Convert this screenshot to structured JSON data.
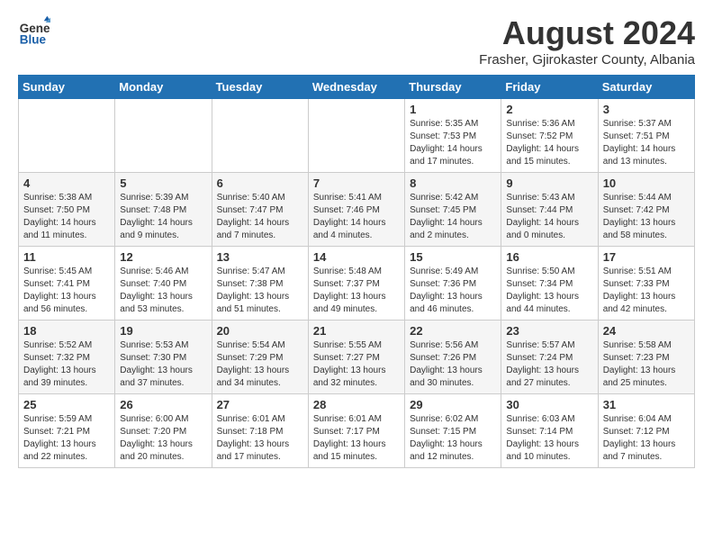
{
  "header": {
    "logo_general": "General",
    "logo_blue": "Blue",
    "main_title": "August 2024",
    "subtitle": "Frasher, Gjirokaster County, Albania"
  },
  "days_of_week": [
    "Sunday",
    "Monday",
    "Tuesday",
    "Wednesday",
    "Thursday",
    "Friday",
    "Saturday"
  ],
  "weeks": [
    {
      "days": [
        {
          "num": "",
          "info": ""
        },
        {
          "num": "",
          "info": ""
        },
        {
          "num": "",
          "info": ""
        },
        {
          "num": "",
          "info": ""
        },
        {
          "num": "1",
          "info": "Sunrise: 5:35 AM\nSunset: 7:53 PM\nDaylight: 14 hours\nand 17 minutes."
        },
        {
          "num": "2",
          "info": "Sunrise: 5:36 AM\nSunset: 7:52 PM\nDaylight: 14 hours\nand 15 minutes."
        },
        {
          "num": "3",
          "info": "Sunrise: 5:37 AM\nSunset: 7:51 PM\nDaylight: 14 hours\nand 13 minutes."
        }
      ]
    },
    {
      "days": [
        {
          "num": "4",
          "info": "Sunrise: 5:38 AM\nSunset: 7:50 PM\nDaylight: 14 hours\nand 11 minutes."
        },
        {
          "num": "5",
          "info": "Sunrise: 5:39 AM\nSunset: 7:48 PM\nDaylight: 14 hours\nand 9 minutes."
        },
        {
          "num": "6",
          "info": "Sunrise: 5:40 AM\nSunset: 7:47 PM\nDaylight: 14 hours\nand 7 minutes."
        },
        {
          "num": "7",
          "info": "Sunrise: 5:41 AM\nSunset: 7:46 PM\nDaylight: 14 hours\nand 4 minutes."
        },
        {
          "num": "8",
          "info": "Sunrise: 5:42 AM\nSunset: 7:45 PM\nDaylight: 14 hours\nand 2 minutes."
        },
        {
          "num": "9",
          "info": "Sunrise: 5:43 AM\nSunset: 7:44 PM\nDaylight: 14 hours\nand 0 minutes."
        },
        {
          "num": "10",
          "info": "Sunrise: 5:44 AM\nSunset: 7:42 PM\nDaylight: 13 hours\nand 58 minutes."
        }
      ]
    },
    {
      "days": [
        {
          "num": "11",
          "info": "Sunrise: 5:45 AM\nSunset: 7:41 PM\nDaylight: 13 hours\nand 56 minutes."
        },
        {
          "num": "12",
          "info": "Sunrise: 5:46 AM\nSunset: 7:40 PM\nDaylight: 13 hours\nand 53 minutes."
        },
        {
          "num": "13",
          "info": "Sunrise: 5:47 AM\nSunset: 7:38 PM\nDaylight: 13 hours\nand 51 minutes."
        },
        {
          "num": "14",
          "info": "Sunrise: 5:48 AM\nSunset: 7:37 PM\nDaylight: 13 hours\nand 49 minutes."
        },
        {
          "num": "15",
          "info": "Sunrise: 5:49 AM\nSunset: 7:36 PM\nDaylight: 13 hours\nand 46 minutes."
        },
        {
          "num": "16",
          "info": "Sunrise: 5:50 AM\nSunset: 7:34 PM\nDaylight: 13 hours\nand 44 minutes."
        },
        {
          "num": "17",
          "info": "Sunrise: 5:51 AM\nSunset: 7:33 PM\nDaylight: 13 hours\nand 42 minutes."
        }
      ]
    },
    {
      "days": [
        {
          "num": "18",
          "info": "Sunrise: 5:52 AM\nSunset: 7:32 PM\nDaylight: 13 hours\nand 39 minutes."
        },
        {
          "num": "19",
          "info": "Sunrise: 5:53 AM\nSunset: 7:30 PM\nDaylight: 13 hours\nand 37 minutes."
        },
        {
          "num": "20",
          "info": "Sunrise: 5:54 AM\nSunset: 7:29 PM\nDaylight: 13 hours\nand 34 minutes."
        },
        {
          "num": "21",
          "info": "Sunrise: 5:55 AM\nSunset: 7:27 PM\nDaylight: 13 hours\nand 32 minutes."
        },
        {
          "num": "22",
          "info": "Sunrise: 5:56 AM\nSunset: 7:26 PM\nDaylight: 13 hours\nand 30 minutes."
        },
        {
          "num": "23",
          "info": "Sunrise: 5:57 AM\nSunset: 7:24 PM\nDaylight: 13 hours\nand 27 minutes."
        },
        {
          "num": "24",
          "info": "Sunrise: 5:58 AM\nSunset: 7:23 PM\nDaylight: 13 hours\nand 25 minutes."
        }
      ]
    },
    {
      "days": [
        {
          "num": "25",
          "info": "Sunrise: 5:59 AM\nSunset: 7:21 PM\nDaylight: 13 hours\nand 22 minutes."
        },
        {
          "num": "26",
          "info": "Sunrise: 6:00 AM\nSunset: 7:20 PM\nDaylight: 13 hours\nand 20 minutes."
        },
        {
          "num": "27",
          "info": "Sunrise: 6:01 AM\nSunset: 7:18 PM\nDaylight: 13 hours\nand 17 minutes."
        },
        {
          "num": "28",
          "info": "Sunrise: 6:01 AM\nSunset: 7:17 PM\nDaylight: 13 hours\nand 15 minutes."
        },
        {
          "num": "29",
          "info": "Sunrise: 6:02 AM\nSunset: 7:15 PM\nDaylight: 13 hours\nand 12 minutes."
        },
        {
          "num": "30",
          "info": "Sunrise: 6:03 AM\nSunset: 7:14 PM\nDaylight: 13 hours\nand 10 minutes."
        },
        {
          "num": "31",
          "info": "Sunrise: 6:04 AM\nSunset: 7:12 PM\nDaylight: 13 hours\nand 7 minutes."
        }
      ]
    }
  ]
}
